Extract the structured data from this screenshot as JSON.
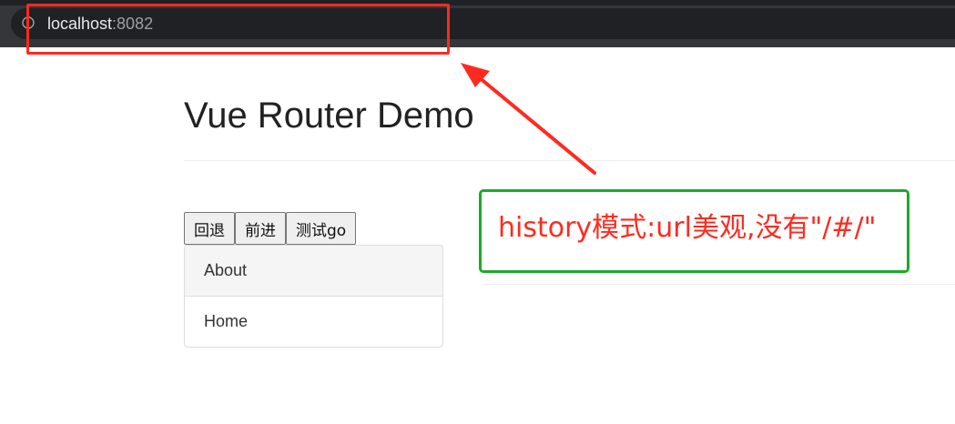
{
  "browser": {
    "url_host": "localhost",
    "url_port": ":8082"
  },
  "page": {
    "title": "Vue Router Demo",
    "buttons": {
      "back": "回退",
      "forward": "前进",
      "go": "测试go"
    },
    "nav_items": [
      "About",
      "Home"
    ],
    "active_nav": "About"
  },
  "annotation": {
    "note": "history模式:url美观,没有\"/#/\"",
    "highlight_color": "#ff2a1f",
    "box_color": "#1aab2a"
  }
}
